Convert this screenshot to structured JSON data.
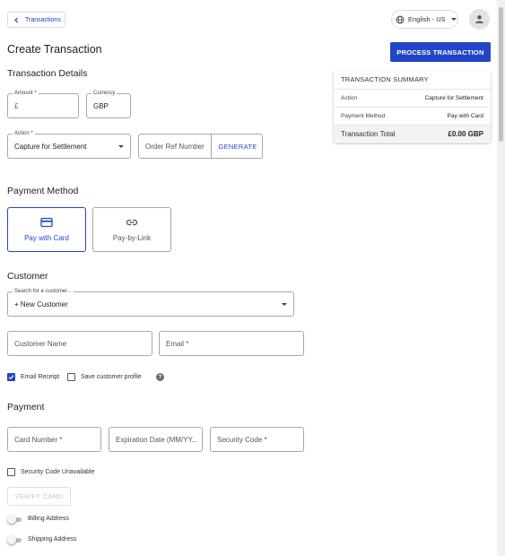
{
  "header": {
    "back_label": "Transactions",
    "language": "English - US"
  },
  "page": {
    "title": "Create Transaction",
    "process_button": "PROCESS TRANSACTION"
  },
  "details": {
    "heading": "Transaction Details",
    "amount_label": "Amount *",
    "amount_prefix": "£",
    "currency_label": "Currency",
    "currency_value": "GBP",
    "action_label": "Action *",
    "action_value": "Capture for Settlement",
    "order_ref_placeholder": "Order Ref Number",
    "generate_label": "GENERATE"
  },
  "payment_method": {
    "heading": "Payment Method",
    "options": [
      {
        "label": "Pay with Card",
        "icon": "credit-card-icon",
        "selected": true
      },
      {
        "label": "Pay-by-Link",
        "icon": "link-icon",
        "selected": false
      }
    ]
  },
  "customer": {
    "heading": "Customer",
    "search_label": "Search for a customer...",
    "search_value": "+ New Customer",
    "name_placeholder": "Customer Name",
    "email_placeholder": "Email *",
    "email_receipt_label": "Email Receipt",
    "email_receipt_checked": true,
    "save_profile_label": "Save customer profile",
    "save_profile_checked": false
  },
  "payment": {
    "heading": "Payment",
    "card_number_placeholder": "Card Number *",
    "expiration_placeholder": "Expiration Date (MM/YY...",
    "security_code_placeholder": "Security Code *",
    "security_unavailable_label": "Security Code Unavailable",
    "verify_label": "VERIFY CARD",
    "billing_label": "Billing Address",
    "shipping_label": "Shipping Address"
  },
  "summary": {
    "heading": "TRANSACTION SUMMARY",
    "rows": [
      {
        "key": "Action",
        "value": "Capture for Settlement"
      },
      {
        "key": "Payment Method",
        "value": "Pay with Card"
      }
    ],
    "total_key": "Transaction Total",
    "total_value": "£0.00 GBP"
  },
  "colors": {
    "accent": "#2346c9",
    "border": "#a8a8a8"
  }
}
